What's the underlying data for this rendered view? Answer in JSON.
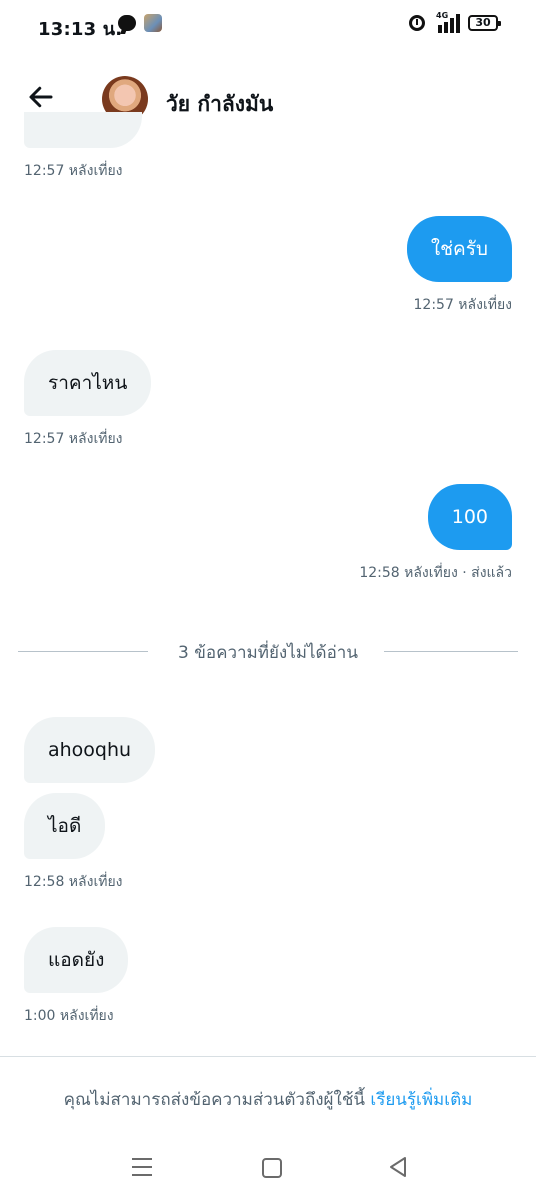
{
  "status_bar": {
    "time": "13:13 น.",
    "network": "4G",
    "battery": "30",
    "icons": [
      "line-icon",
      "photo-icon",
      "alarm-icon",
      "signal-icon",
      "battery-icon"
    ]
  },
  "header": {
    "back_icon": "arrow-left-icon",
    "title": "วัย กำลังมัน"
  },
  "messages": {
    "partial_timestamp": "12:57 หลังเที่ยง",
    "m1_text": "ใช่ครับ",
    "m1_time": "12:57 หลังเที่ยง",
    "m2_text": "ราคาไหน",
    "m2_time": "12:57 หลังเที่ยง",
    "m3_text": "100",
    "m3_time": "12:58 หลังเที่ยง · ส่งแล้ว",
    "unread_label": "3 ข้อความที่ยังไม่ได้อ่าน",
    "m4_text": "ahooqhu",
    "m5_text": "ไอดี",
    "m5_time": "12:58 หลังเที่ยง",
    "m6_text": "แอดยัง",
    "m6_time": "1:00 หลังเที่ยง"
  },
  "footer": {
    "notice": "คุณไม่สามารถส่งข้อความส่วนตัวถึงผู้ใช้นี้ ",
    "link": "เรียนรู้เพิ่มเติม"
  },
  "nav": {
    "icons": [
      "recent-apps-icon",
      "home-icon",
      "back-triangle-icon"
    ]
  },
  "colors": {
    "accent": "#1d9bf0",
    "incoming_bubble": "#eff3f4",
    "secondary_text": "#536471"
  }
}
